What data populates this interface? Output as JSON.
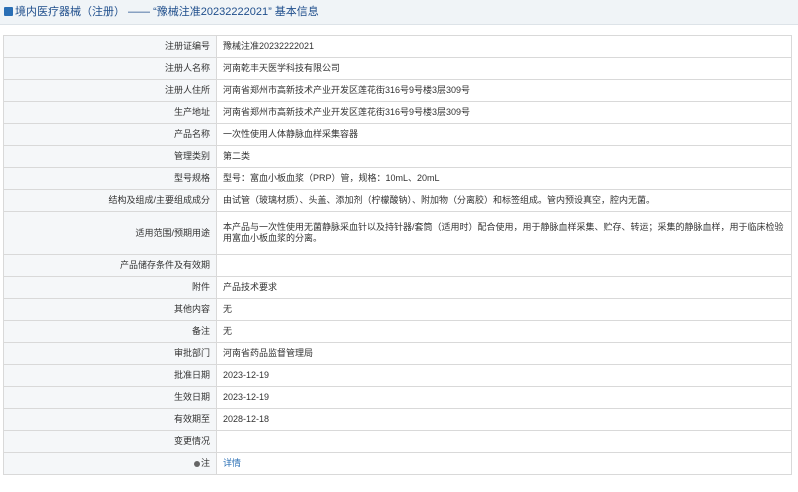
{
  "header": {
    "title": "境内医疗器械（注册） —— “豫械注准20232222021” 基本信息"
  },
  "rows": [
    {
      "label": "注册证编号",
      "value": "豫械注准20232222021"
    },
    {
      "label": "注册人名称",
      "value": "河南乾丰天医学科技有限公司"
    },
    {
      "label": "注册人住所",
      "value": "河南省郑州市高新技术产业开发区莲花街316号9号楼3层309号"
    },
    {
      "label": "生产地址",
      "value": "河南省郑州市高新技术产业开发区莲花街316号9号楼3层309号"
    },
    {
      "label": "产品名称",
      "value": "一次性使用人体静脉血样采集容器"
    },
    {
      "label": "管理类别",
      "value": "第二类"
    },
    {
      "label": "型号规格",
      "value": "型号：富血小板血浆（PRP）管，规格：10mL、20mL"
    },
    {
      "label": "结构及组成/主要组成成分",
      "value": "由试管（玻璃材质）、头盖、添加剂（柠檬酸钠）、附加物（分离胶）和标签组成。管内预设真空，腔内无菌。"
    },
    {
      "label": "适用范围/预期用途",
      "value": "本产品与一次性使用无菌静脉采血针以及持针器/套筒（适用时）配合使用，用于静脉血样采集、贮存、转运；采集的静脉血样，用于临床检验用富血小板血浆的分离。"
    },
    {
      "label": "产品储存条件及有效期",
      "value": ""
    },
    {
      "label": "附件",
      "value": "产品技术要求"
    },
    {
      "label": "其他内容",
      "value": "无"
    },
    {
      "label": "备注",
      "value": "无"
    },
    {
      "label": "审批部门",
      "value": "河南省药品监督管理局"
    },
    {
      "label": "批准日期",
      "value": "2023-12-19"
    },
    {
      "label": "生效日期",
      "value": "2023-12-19"
    },
    {
      "label": "有效期至",
      "value": "2028-12-18"
    },
    {
      "label": "变更情况",
      "value": ""
    },
    {
      "label": "注",
      "value": "详情"
    }
  ]
}
